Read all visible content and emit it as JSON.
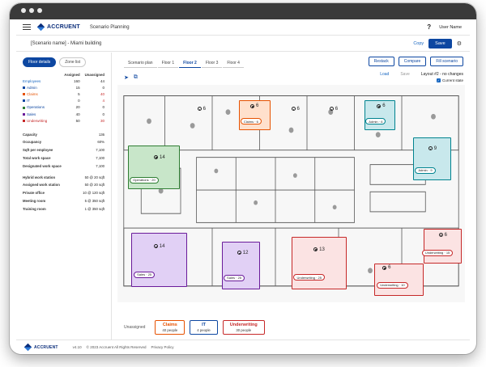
{
  "app": {
    "brand": "ACCRUENT",
    "title": "Scenario Planning",
    "user_name": "User Name",
    "help": "?"
  },
  "subbar": {
    "scenario_title": "[Scenario name] - Miami building",
    "copy_label": "Copy",
    "save_label": "Save"
  },
  "sidebar": {
    "tabs": [
      {
        "label": "Floor details",
        "active": true
      },
      {
        "label": "Zone list",
        "active": false
      }
    ],
    "columns": {
      "assigned": "Assigned",
      "unassigned": "Unassigned"
    },
    "departments": [
      {
        "name": "Employees",
        "assigned": "160",
        "unassigned": "44",
        "color": ""
      },
      {
        "name": "Admin",
        "assigned": "15",
        "unassigned": "0",
        "color": "#0d47a1"
      },
      {
        "name": "Claims",
        "assigned": "5",
        "unassigned": "40",
        "color": "#e65100"
      },
      {
        "name": "IT",
        "assigned": "0",
        "unassigned": "4",
        "color": "#0d47a1"
      },
      {
        "name": "Operations",
        "assigned": "20",
        "unassigned": "0",
        "color": "#2e7d32"
      },
      {
        "name": "Sales",
        "assigned": "40",
        "unassigned": "0",
        "color": "#6a1b9a"
      },
      {
        "name": "Underwriting",
        "assigned": "50",
        "unassigned": "30",
        "color": "#c62828"
      }
    ],
    "stats": [
      {
        "label": "Capacity",
        "value": "136"
      },
      {
        "label": "Occupancy",
        "value": "60%"
      },
      {
        "label": "Sqft per employee",
        "value": "7,100"
      },
      {
        "label": "Total work space",
        "value": "7,100"
      },
      {
        "label": "Designated work space",
        "value": "7,100"
      }
    ],
    "space_types": [
      {
        "label": "Hybrid work station",
        "value": "50 @ 20 sqft"
      },
      {
        "label": "Assigned work station",
        "value": "50 @ 20 sqft"
      },
      {
        "label": "Private office",
        "value": "10 @ 120 sqft"
      },
      {
        "label": "Meeting room",
        "value": "5 @ 350 sqft"
      },
      {
        "label": "Training room",
        "value": "1 @ 350 sqft"
      }
    ]
  },
  "floors": [
    {
      "label": "Scenario plan",
      "active": false
    },
    {
      "label": "Floor 1",
      "active": false
    },
    {
      "label": "Floor 2",
      "active": true
    },
    {
      "label": "Floor 3",
      "active": false
    },
    {
      "label": "Floor 4",
      "active": false
    }
  ],
  "actions": {
    "restack": "Restack",
    "compare": "Compare",
    "fill": "Fill scenario"
  },
  "layout": {
    "load": "Load",
    "save": "Save",
    "name": "Layout #2 - no changes",
    "current_state": "Current state"
  },
  "zones": [
    {
      "name": "Operations",
      "label": "Operations · 20",
      "seats": "14",
      "color": "#c8e6c9",
      "border": "#2e7d32"
    },
    {
      "name": "Claims",
      "label": "Claims · 6",
      "seats": "6",
      "color": "#ffe0cc",
      "border": "#e65100"
    },
    {
      "name": "Admin",
      "label": "Admin · 6",
      "seats": "6",
      "color": "#c8e8ec",
      "border": "#00838f"
    },
    {
      "name": "Admin",
      "label": "Admin · 9",
      "seats": "9",
      "color": "#c8e8ec",
      "border": "#00838f"
    },
    {
      "name": "Sales",
      "label": "Sales · 25",
      "seats": "14",
      "color": "#e1d0f5",
      "border": "#6a1b9a"
    },
    {
      "name": "Sales",
      "label": "Sales · 25",
      "seats": "12",
      "color": "#e1d0f5",
      "border": "#6a1b9a"
    },
    {
      "name": "Underwriting",
      "label": "Underwriting · 25",
      "seats": "13",
      "color": "#fbe3e3",
      "border": "#c62828"
    },
    {
      "name": "Underwriting",
      "label": "Underwriting · 15",
      "seats": "6",
      "color": "#fbe3e3",
      "border": "#c62828"
    },
    {
      "name": "Underwriting",
      "label": "Underwriting · 10",
      "seats": "6",
      "color": "#fbe3e3",
      "border": "#c62828"
    }
  ],
  "plain_seats": [
    "6",
    "6",
    "6"
  ],
  "unassigned": {
    "label": "Unassigned",
    "cards": [
      {
        "name": "Claims",
        "count": "40 people",
        "color": "#e65100"
      },
      {
        "name": "IT",
        "count": "4 people",
        "color": "#0d47a1"
      },
      {
        "name": "Underwriting",
        "count": "30 people",
        "color": "#c62828"
      }
    ]
  },
  "footer": {
    "brand": "ACCRUENT",
    "version": "v4.10",
    "copyright": "© 2023 Accruent All Rights Reserved",
    "privacy": "Privacy Policy"
  }
}
